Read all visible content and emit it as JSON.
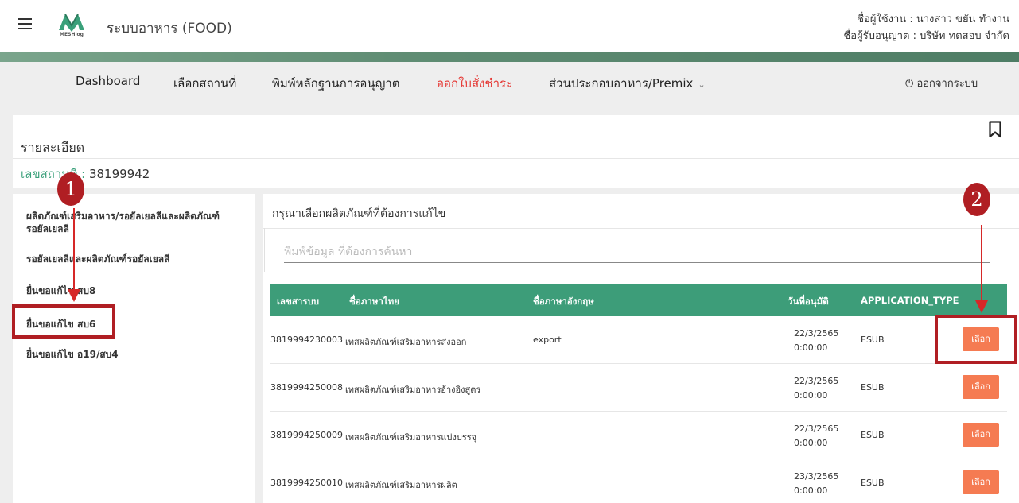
{
  "header": {
    "app_title": "ระบบอาหาร (FOOD)",
    "logo_text": "MESHlog",
    "user_line1": "ชื่อผู้ใช้งาน : นางสาว ขยัน ทำงาน",
    "user_line2": "ชื่อผู้รับอนุญาต : บริษัท ทดสอบ จำกัด"
  },
  "nav": {
    "items": [
      {
        "label": "Dashboard"
      },
      {
        "label": "เลือกสถานที่"
      },
      {
        "label": "พิมพ์หลักฐานการอนุญาต"
      },
      {
        "label": "ออกใบสั่งชำระ"
      },
      {
        "label": "ส่วนประกอบอาหาร/Premix"
      }
    ],
    "dropdown_chevron": "⌄",
    "logout_label": "ออกจากระบบ",
    "logout_icon": "⏻"
  },
  "detail": {
    "title": "รายละเอียด",
    "id_label": "เลขสถานที่ : ",
    "id_value": "38199942"
  },
  "sidebar": {
    "items": [
      {
        "label": "ผลิตภัณฑ์เสริมอาหาร/รอยัลเยลลีและผลิตภัณฑ์รอยัลเยลลี"
      },
      {
        "label": "รอยัลเยลลีและผลิตภัณฑ์รอยัลเยลลี"
      },
      {
        "label": "ยื่นขอแก้ไข สบ8"
      },
      {
        "label": "ยื่นขอแก้ไข สบ6"
      },
      {
        "label": "ยื่นขอแก้ไข อ19/สบ4"
      }
    ]
  },
  "main": {
    "title": "กรุณาเลือกผลิตภัณฑ์ที่ต้องการแก้ไข",
    "search_placeholder": "พิมพ์ข้อมูล ที่ต้องการค้นหา",
    "headers": [
      "เลขสารบบ",
      "ชื่อภาษาไทย",
      "ชื่อภาษาอังกฤษ",
      "วันที่อนุมัติ",
      "APPLICATION_TYPE"
    ],
    "rows": [
      {
        "code": "3819994230003",
        "name_th": "เทสผลิตภัณฑ์เสริมอาหารส่งออก",
        "name_en": "export",
        "date": "22/3/2565",
        "time": "0:00:00",
        "type": "ESUB",
        "action": "เลือก"
      },
      {
        "code": "3819994250008",
        "name_th": "เทสผลิตภัณฑ์เสริมอาหารอ้างอิงสูตร",
        "name_en": "",
        "date": "22/3/2565",
        "time": "0:00:00",
        "type": "ESUB",
        "action": "เลือก"
      },
      {
        "code": "3819994250009",
        "name_th": "เทสผลิตภัณฑ์เสริมอาหารแบ่งบรรจุ",
        "name_en": "",
        "date": "22/3/2565",
        "time": "0:00:00",
        "type": "ESUB",
        "action": "เลือก"
      },
      {
        "code": "3819994250010",
        "name_th": "เทสผลิตภัณฑ์เสริมอาหารผลิต",
        "name_en": "",
        "date": "23/3/2565",
        "time": "0:00:00",
        "type": "ESUB",
        "action": "เลือก"
      }
    ]
  },
  "annotations": {
    "marker1": "1",
    "marker2": "2"
  },
  "colors": {
    "accent_green": "#3d9d79",
    "active_nav": "#e53935",
    "button": "#f57b52",
    "annotation": "#b01e23"
  }
}
